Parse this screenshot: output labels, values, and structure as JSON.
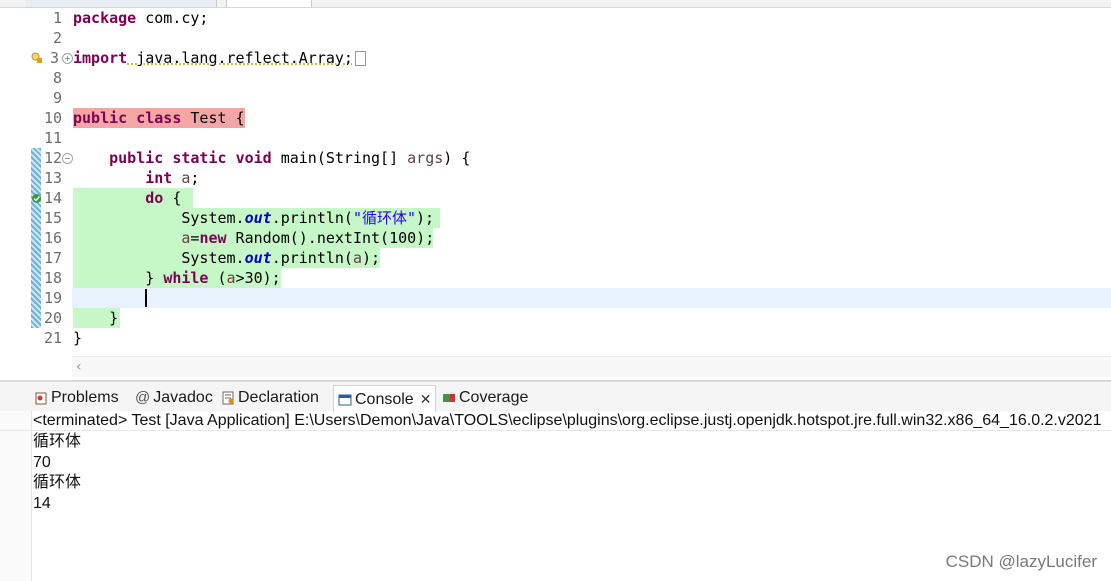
{
  "editor": {
    "lines": [
      {
        "n": "1"
      },
      {
        "n": "2"
      },
      {
        "n": "3"
      },
      {
        "n": "8"
      },
      {
        "n": "9"
      },
      {
        "n": "10"
      },
      {
        "n": "11"
      },
      {
        "n": "12"
      },
      {
        "n": "13"
      },
      {
        "n": "14"
      },
      {
        "n": "15"
      },
      {
        "n": "16"
      },
      {
        "n": "17"
      },
      {
        "n": "18"
      },
      {
        "n": "19"
      },
      {
        "n": "20"
      },
      {
        "n": "21"
      }
    ],
    "code": {
      "l1_kw": "package",
      "l1_rest": " com.cy;",
      "l3_kw": "import",
      "l3_rest": " java.lang.reflect.Array;",
      "l10_kw1": "public",
      "l10_kw2": "class",
      "l10_rest": " Test {",
      "l12_kw1": "public",
      "l12_kw2": "static",
      "l12_kw3": "void",
      "l12_a": " main(String[] ",
      "l12_var": "args",
      "l12_b": ") {",
      "l13_kw": "int",
      "l13_var": "a",
      "l13_b": ";",
      "l14_kw": "do",
      "l14_b": " {",
      "l15_a": "System.",
      "l15_fld": "out",
      "l15_b": ".println(",
      "l15_str": "\"循环体\"",
      "l15_c": ");",
      "l16_var": "a",
      "l16_eq": "=",
      "l16_kw": "new",
      "l16_b": " Random().nextInt(100);",
      "l17_a": "System.",
      "l17_fld": "out",
      "l17_b": ".println(",
      "l17_var": "a",
      "l17_c": ");",
      "l18_a": "} ",
      "l18_kw": "while",
      "l18_b": " (",
      "l18_var": "a",
      "l18_c": ">30);",
      "l20": "}",
      "l21": "}"
    }
  },
  "panel": {
    "tabs": {
      "problems": "Problems",
      "javadoc": "Javadoc",
      "declaration": "Declaration",
      "console": "Console",
      "coverage": "Coverage"
    },
    "status": "<terminated> Test [Java Application] E:\\Users\\Demon\\Java\\TOOLS\\eclipse\\plugins\\org.eclipse.justj.openjdk.hotspot.jre.full.win32.x86_64_16.0.2.v2021",
    "output": [
      "循环体",
      "70",
      "循环体",
      "14"
    ]
  },
  "watermark": "CSDN @lazyLucifer",
  "colors": {
    "keyword": "#7f0055",
    "string": "#2a00ff",
    "field": "#0000c0",
    "error_highlight": "#f4a6a4",
    "coverage_green": "#c6f7c6"
  }
}
